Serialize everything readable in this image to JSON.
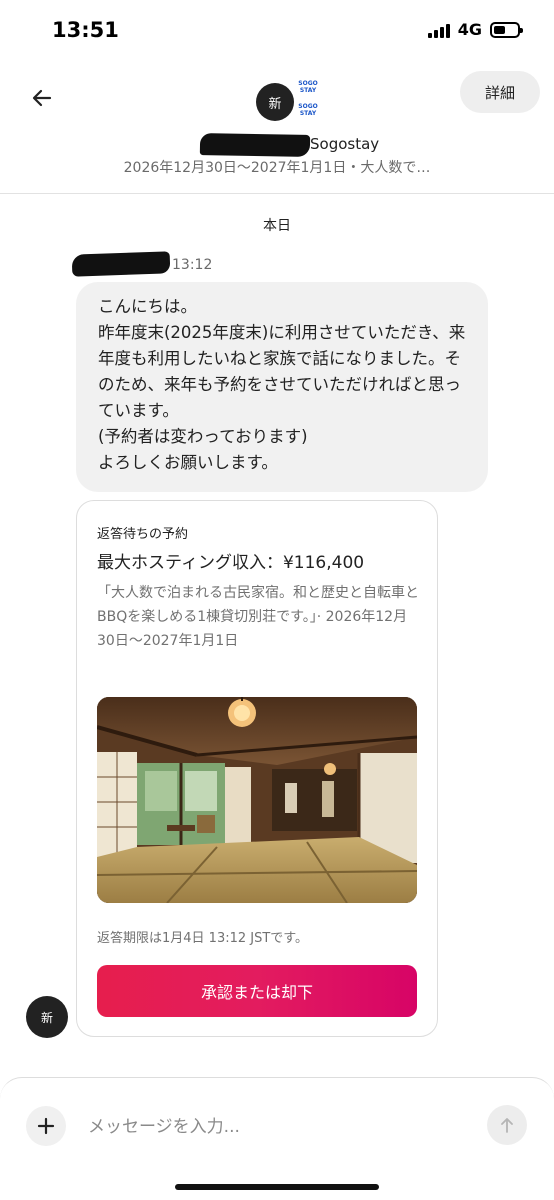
{
  "status_bar": {
    "time": "13:51",
    "network": "4G"
  },
  "header": {
    "avatar_text": "新",
    "logo_top": "SOGO STAY",
    "logo_bottom": "SOGO STAY",
    "details_label": "詳細",
    "host_name_visible": "Sogostay",
    "trip_summary": "2026年12月30日～2027年1月1日・大人数で…"
  },
  "conversation": {
    "date_label": "本日",
    "message": {
      "time": "13:12",
      "text": "こんにちは。\n昨年度末(2025年度末)に利用させていただき、来年度も利用したいねと家族で話になりました。そのため、来年も予約をさせていただければと思っています。\n(予約者は変わっております)\nよろしくお願いします。"
    },
    "request_card": {
      "eyebrow": "返答待ちの予約",
      "payout": "最大ホスティング収入：¥116,400",
      "description": "「大人数で泊まれる古民家宿。和と歴史と自転車とBBQを楽しめる1棟貸切別荘です。」· 2026年12月30日～2027年1月1日",
      "deadline": "返答期限は1月4日 13:12 JSTです。",
      "action_label": "承認または却下"
    },
    "sender_avatar_text": "新"
  },
  "composer": {
    "placeholder": "メッセージを入力..."
  },
  "icons": {
    "back": "arrow-left-icon",
    "add": "plus-icon",
    "send": "arrow-up-icon"
  },
  "colors": {
    "accent": "#E61E4D",
    "muted": "#717171",
    "bubble": "#F1F1F1"
  }
}
